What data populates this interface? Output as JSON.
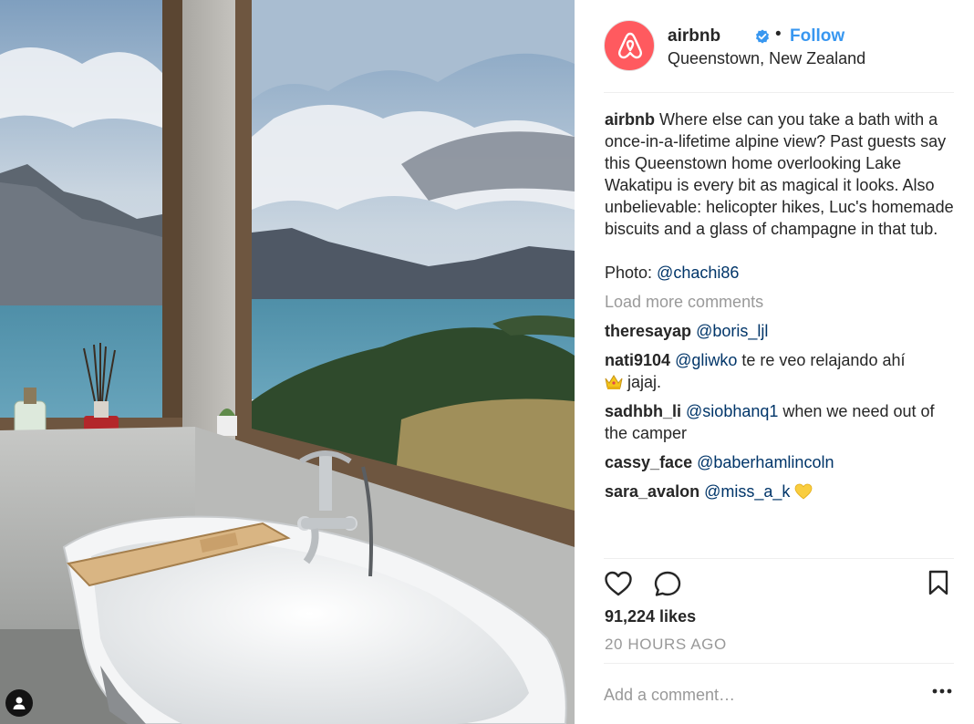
{
  "post": {
    "photo_alt_icon": "person-tag-icon",
    "colors": {
      "brand": "#ff5a5f",
      "link_blue": "#3897f0",
      "mention_blue": "#003569",
      "muted_gray": "#999999",
      "text_dark": "#262626",
      "divider": "#efefef"
    }
  },
  "header": {
    "username": "airbnb",
    "verified_icon": "verified-badge-icon",
    "separator": "•",
    "follow_label": "Follow",
    "location": "Queenstown, New Zealand"
  },
  "caption": {
    "username": "airbnb",
    "text": " Where else can you take a bath with a once-in-a-lifetime alpine view? Past guests say this Queenstown home overlooking Lake Wakatipu is every bit as magical it looks. Also unbelievable: helicopter hikes, Luc's homemade biscuits and a glass of champagne in that tub.",
    "credit_label": "Photo: ",
    "credit_mention": "@chachi86"
  },
  "load_more_label": "Load more comments",
  "comments": [
    {
      "user": "theresayap",
      "mention": "@boris_ljl",
      "text": ""
    },
    {
      "user": "nati9104",
      "mention": "@gliwko",
      "text": " te re veo relajando ahí",
      "emoji": "crown-emoji",
      "tail": " jajaj."
    },
    {
      "user": "sadhbh_li",
      "mention": "@siobhanq1",
      "text": " when we need out of the camper"
    },
    {
      "user": "cassy_face",
      "mention": "@baberhamlincoln",
      "text": ""
    },
    {
      "user": "sara_avalon",
      "mention": "@miss_a_k",
      "text": "",
      "emoji": "yellow-heart-emoji"
    }
  ],
  "actions": {
    "like_icon": "heart-icon",
    "comment_icon": "comment-bubble-icon",
    "save_icon": "bookmark-icon"
  },
  "likes": "91,224 likes",
  "timestamp": "20 HOURS AGO",
  "add_comment": {
    "placeholder": "Add a comment…",
    "more_icon": "more-options-icon"
  }
}
